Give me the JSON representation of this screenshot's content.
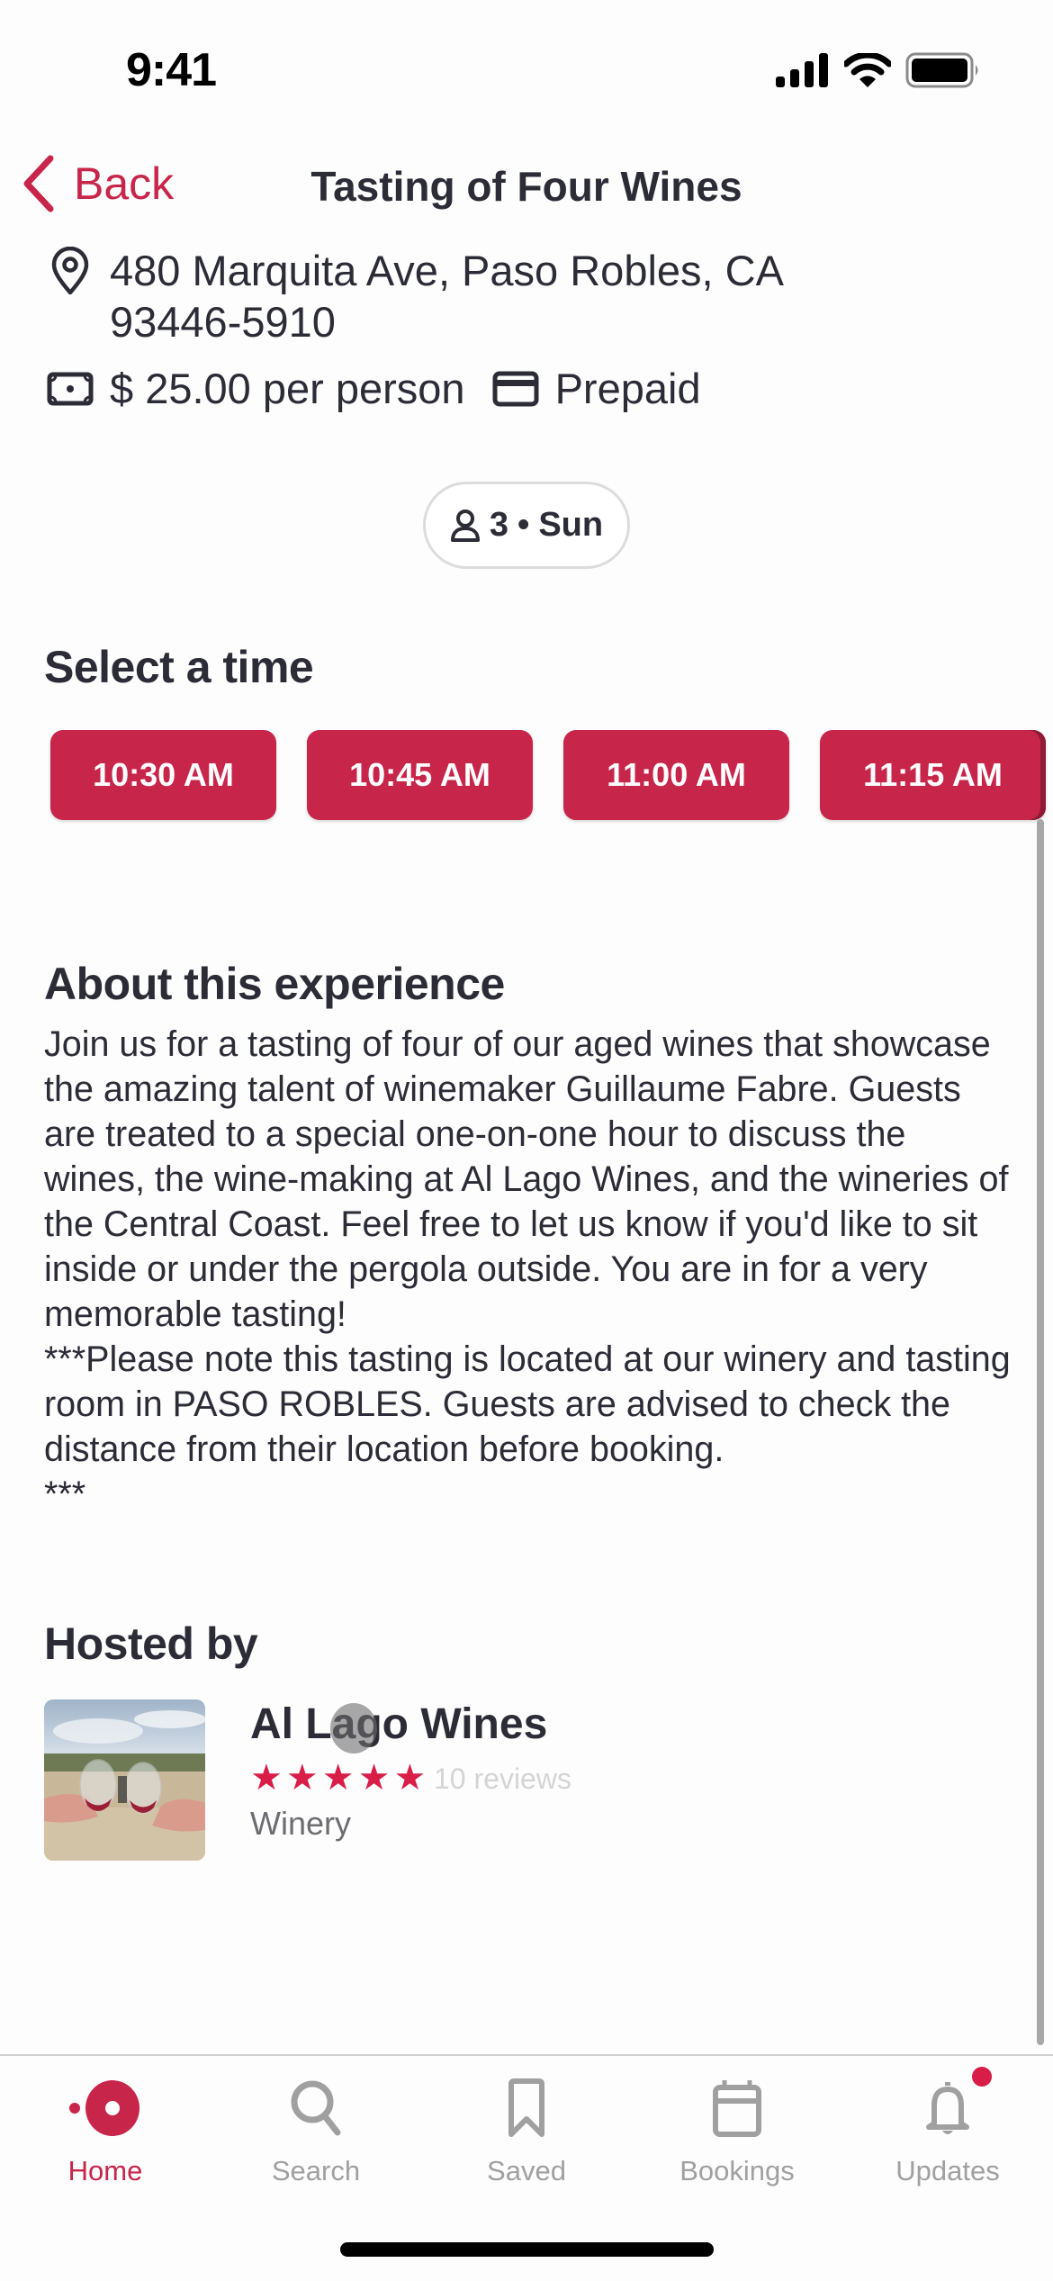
{
  "status_bar": {
    "time": "9:41",
    "icons": [
      "signal-icon",
      "wifi-icon",
      "battery-icon"
    ]
  },
  "nav": {
    "back_label": "Back",
    "title": "Tasting of Four Wines"
  },
  "details": {
    "address": "480 Marquita Ave, Paso Robles, CA 93446-5910",
    "price": "$ 25.00 per person",
    "payment": "Prepaid"
  },
  "party_chip": {
    "guests": "3",
    "separator": "•",
    "day": "Sun"
  },
  "select_time": {
    "heading": "Select a time",
    "slots": [
      "10:30 AM",
      "10:45 AM",
      "11:00 AM",
      "11:15 AM"
    ]
  },
  "about": {
    "heading": "About this experience",
    "body": "Join us for a tasting of four of our aged wines that showcase the amazing talent of winemaker Guillaume Fabre. Guests are treated to a special one-on-one hour to discuss the wines, the wine-making at Al Lago Wines, and the wineries of the Central Coast. Feel free to let us know if you'd like to sit inside or under the pergola outside. You are in for a very memorable tasting!\n***Please note this tasting is located at our winery and tasting room in PASO ROBLES.  Guests are advised to check the distance from their location before booking.\n***"
  },
  "host": {
    "heading": "Hosted by",
    "name": "Al Lago Wines",
    "rating": 5,
    "rating_max": 5,
    "reviews": "10 reviews",
    "type": "Winery"
  },
  "tabbar": {
    "items": [
      {
        "label": "Home",
        "icon": "home-logo-icon",
        "active": true
      },
      {
        "label": "Search",
        "icon": "search-icon",
        "active": false
      },
      {
        "label": "Saved",
        "icon": "bookmark-icon",
        "active": false
      },
      {
        "label": "Bookings",
        "icon": "calendar-icon",
        "active": false
      },
      {
        "label": "Updates",
        "icon": "bell-icon",
        "active": false,
        "badge": true
      }
    ]
  },
  "colors": {
    "accent": "#c8254a",
    "star": "#d81e48",
    "text": "#2b2c36",
    "inactive": "#a0a0a0"
  }
}
